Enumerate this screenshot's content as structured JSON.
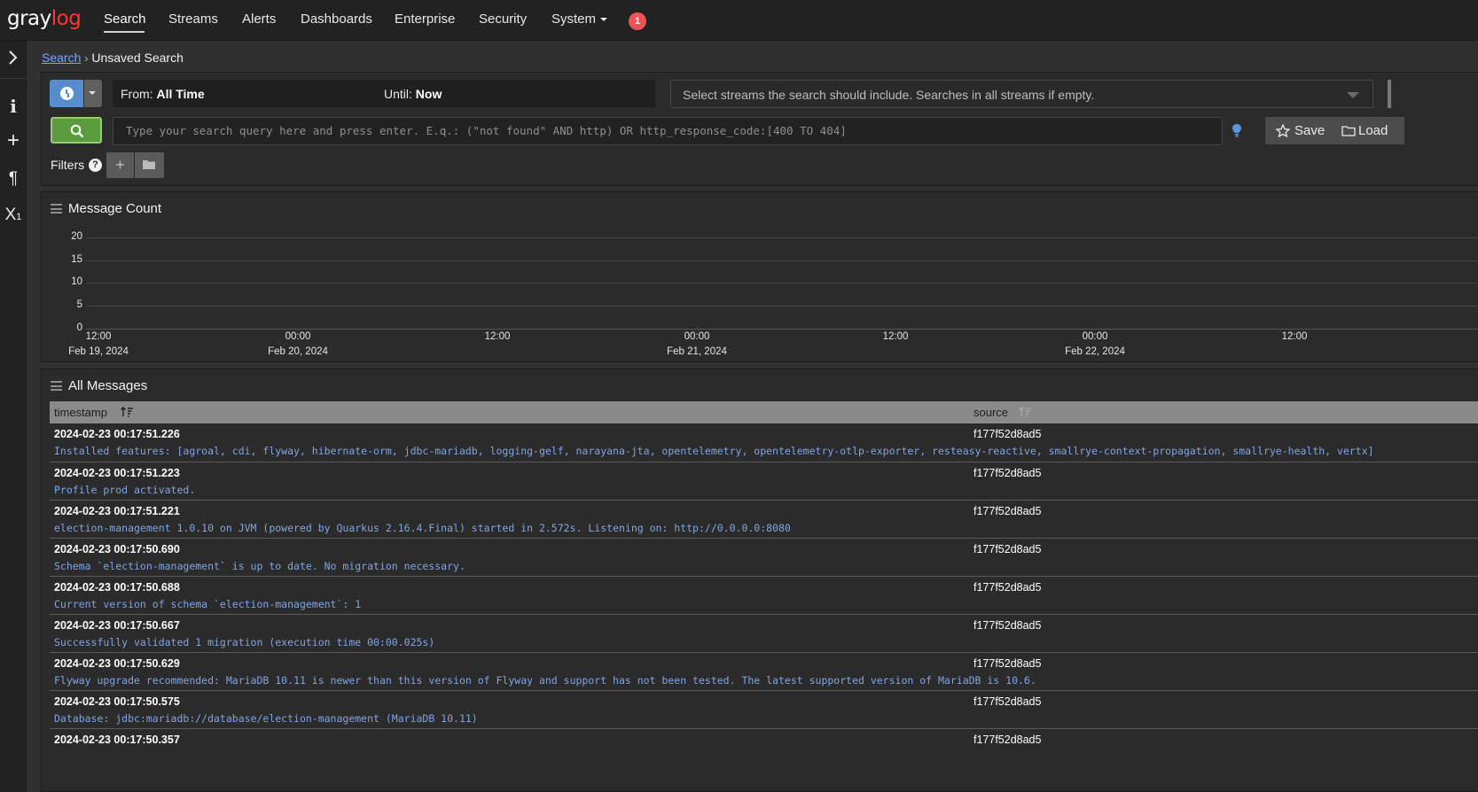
{
  "brand": {
    "logo_part1": "gray",
    "logo_part2": "log"
  },
  "nav": {
    "items": [
      "Search",
      "Streams",
      "Alerts",
      "Dashboards",
      "Enterprise",
      "Security",
      "System"
    ],
    "notification_count": "1"
  },
  "breadcrumb": {
    "root": "Search",
    "current": "Unsaved Search"
  },
  "sidebar": {
    "icons": [
      "chevron-right-icon",
      "info-icon",
      "plus-icon",
      "paragraph-icon",
      "subscript-icon"
    ]
  },
  "search": {
    "from_label": "From:",
    "from_value": "All Time",
    "until_label": "Until:",
    "until_value": "Now",
    "streams_placeholder": "Select streams the search should include. Searches in all streams if empty.",
    "query_placeholder": "Type your search query here and press enter. E.q.: (\"not found\" AND http) OR http_response_code:[400 TO 404]",
    "save_label": "Save",
    "load_label": "Load",
    "filters_label": "Filters",
    "filters_add": "+"
  },
  "message_count": {
    "title": "Message Count"
  },
  "chart_data": {
    "type": "bar",
    "title": "Message Count",
    "yticks": [
      "20",
      "15",
      "10",
      "5",
      "0"
    ],
    "ylim": [
      0,
      20
    ],
    "xtick_times": [
      "12:00",
      "00:00",
      "12:00",
      "00:00",
      "12:00",
      "00:00",
      "12:00"
    ],
    "xtick_dates": [
      "Feb 19, 2024",
      "Feb 20, 2024",
      "",
      "Feb 21, 2024",
      "",
      "Feb 22, 2024",
      ""
    ],
    "values": [],
    "grid": true
  },
  "messages": {
    "title": "All Messages",
    "columns": [
      "timestamp",
      "source"
    ],
    "rows": [
      {
        "timestamp": "2024-02-23 00:17:51.226",
        "source": "f177f52d8ad5",
        "message": "Installed features: [agroal, cdi, flyway, hibernate-orm, jdbc-mariadb, logging-gelf, narayana-jta, opentelemetry, opentelemetry-otlp-exporter, resteasy-reactive, smallrye-context-propagation, smallrye-health, vertx]"
      },
      {
        "timestamp": "2024-02-23 00:17:51.223",
        "source": "f177f52d8ad5",
        "message": "Profile prod activated."
      },
      {
        "timestamp": "2024-02-23 00:17:51.221",
        "source": "f177f52d8ad5",
        "message": "election-management 1.0.10 on JVM (powered by Quarkus 2.16.4.Final) started in 2.572s. Listening on: http://0.0.0.0:8080"
      },
      {
        "timestamp": "2024-02-23 00:17:50.690",
        "source": "f177f52d8ad5",
        "message": "Schema `election-management` is up to date. No migration necessary."
      },
      {
        "timestamp": "2024-02-23 00:17:50.688",
        "source": "f177f52d8ad5",
        "message": "Current version of schema `election-management`: 1"
      },
      {
        "timestamp": "2024-02-23 00:17:50.667",
        "source": "f177f52d8ad5",
        "message": "Successfully validated 1 migration (execution time 00:00.025s)"
      },
      {
        "timestamp": "2024-02-23 00:17:50.629",
        "source": "f177f52d8ad5",
        "message": "Flyway upgrade recommended: MariaDB 10.11 is newer than this version of Flyway and support has not been tested. The latest supported version of MariaDB is 10.6."
      },
      {
        "timestamp": "2024-02-23 00:17:50.575",
        "source": "f177f52d8ad5",
        "message": "Database: jdbc:mariadb://database/election-management (MariaDB 10.11)"
      },
      {
        "timestamp": "2024-02-23 00:17:50.357",
        "source": "f177f52d8ad5",
        "message": ""
      }
    ]
  },
  "colors": {
    "accent": "#578dcc",
    "search_button": "#5a9b3d",
    "brand_red": "#ff3633",
    "badge": "#eb5454",
    "message_text": "#7fa5e3"
  }
}
